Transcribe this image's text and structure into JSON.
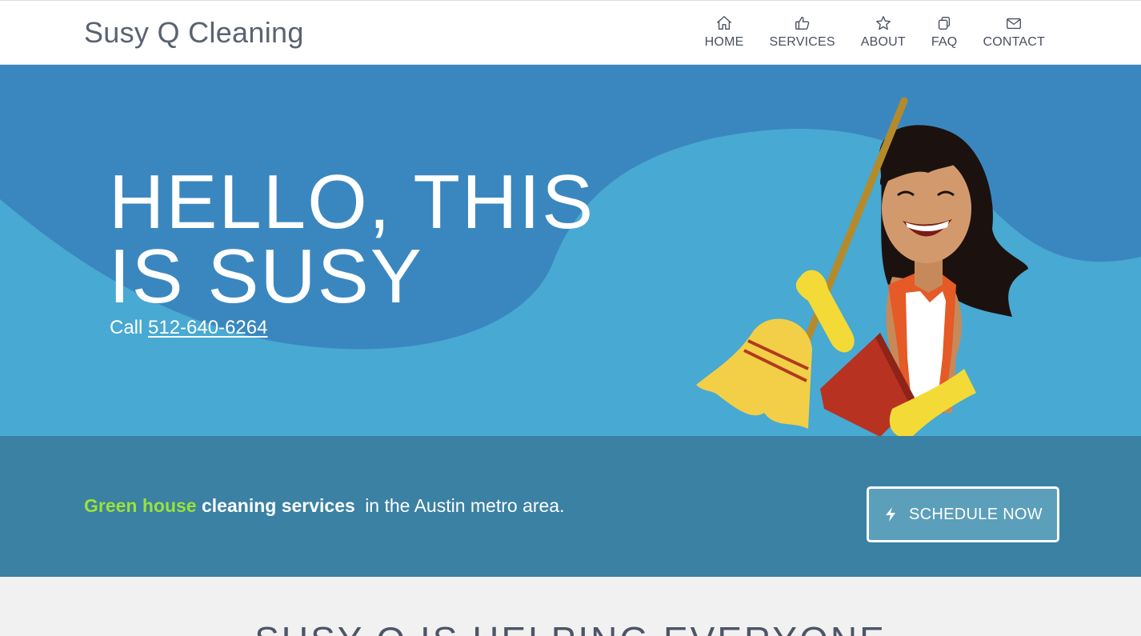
{
  "header": {
    "brand": "Susy Q Cleaning",
    "nav": [
      {
        "label": "HOME",
        "icon": "home-icon"
      },
      {
        "label": "SERVICES",
        "icon": "thumbs-up-icon"
      },
      {
        "label": "ABOUT",
        "icon": "star-icon"
      },
      {
        "label": "FAQ",
        "icon": "copy-icon"
      },
      {
        "label": "CONTACT",
        "icon": "envelope-icon"
      }
    ]
  },
  "hero": {
    "title": "HELLO, THIS IS SUSY",
    "call_prefix": "Call",
    "phone": "512-640-6264",
    "illustration": "cleaning-lady-with-broom-illustration"
  },
  "band": {
    "green_text": "Green house",
    "bold_text": "cleaning services",
    "rest_text": "in the Austin metro area.",
    "button_label": "SCHEDULE NOW",
    "button_icon": "lightning-icon"
  },
  "section2": {
    "heading": "SUSY Q IS HELPING EVERYONE"
  },
  "colors": {
    "header_bg": "#ffffff",
    "hero_light": "#48a9d2",
    "hero_dark": "#3a87c0",
    "band_bg": "#3a81a3",
    "accent_green": "#9be13a",
    "section_bg": "#f1f1f2"
  }
}
